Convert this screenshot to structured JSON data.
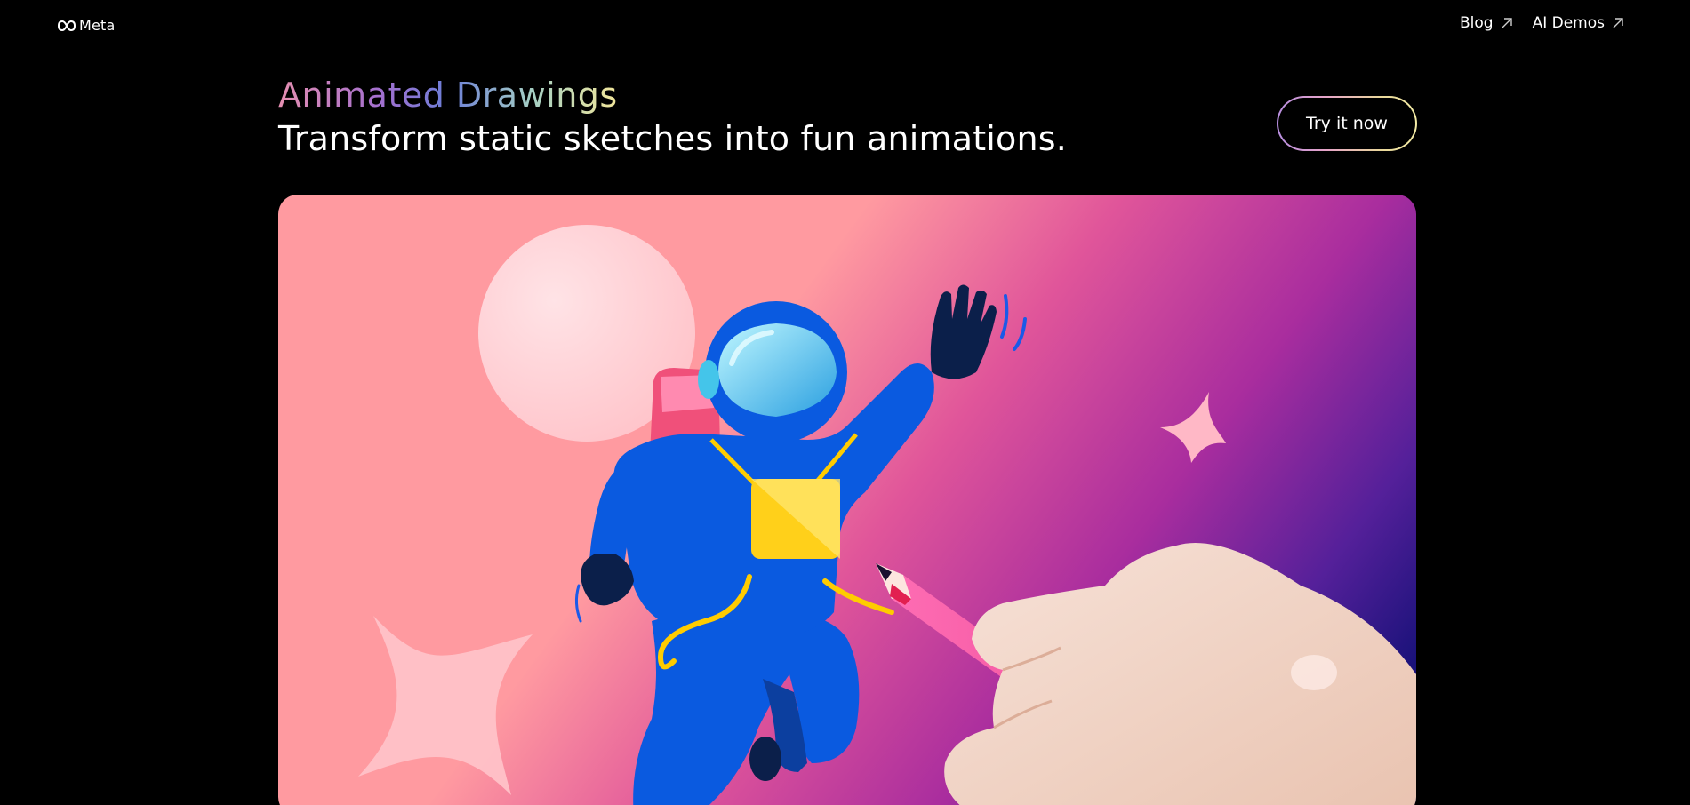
{
  "brand": {
    "logo_text": "Meta"
  },
  "nav": {
    "items": [
      {
        "label": "Blog"
      },
      {
        "label": "AI Demos"
      }
    ]
  },
  "hero": {
    "title": "Animated Drawings",
    "tagline": "Transform static sketches into fun animations.",
    "cta_label": "Try it now"
  },
  "colors": {
    "background": "#000000",
    "illustration_pink": "#ff9aa0",
    "illustration_purple": "#b0309b",
    "illustration_navy": "#1a127a",
    "astronaut_blue": "#0a5ae0"
  },
  "icons": {
    "external_link": "arrow-up-right-icon",
    "logo": "meta-infinity-icon"
  }
}
